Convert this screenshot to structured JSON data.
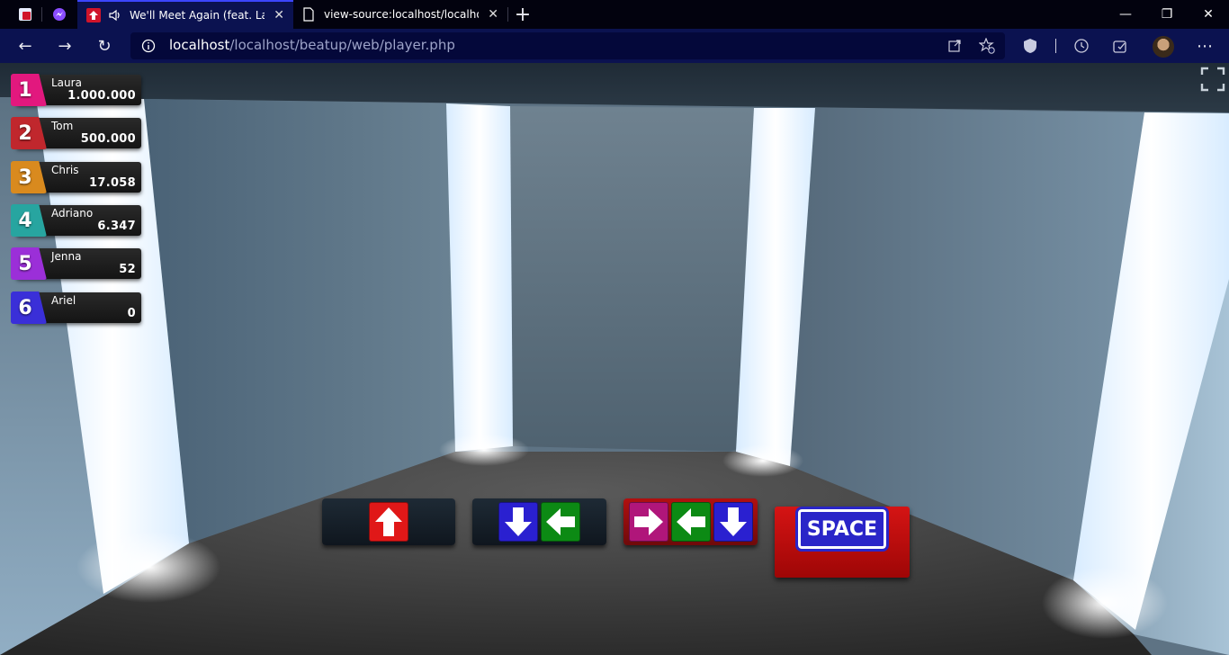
{
  "browser": {
    "tabs": [
      {
        "title": "We'll Meet Again (feat. Laura"
      },
      {
        "title": "view-source:localhost/localhost/b"
      }
    ],
    "url_host": "localhost",
    "url_path": "/localhost/beatup/web/player.php"
  },
  "leaderboard": [
    {
      "rank": "1",
      "name": "Laura",
      "score": "1.000.000",
      "color": "#e2187e"
    },
    {
      "rank": "2",
      "name": "Tom",
      "score": "500.000",
      "color": "#c0272d"
    },
    {
      "rank": "3",
      "name": "Chris",
      "score": "17.058",
      "color": "#d98a1e"
    },
    {
      "rank": "4",
      "name": "Adriano",
      "score": "6.347",
      "color": "#27a5a0"
    },
    {
      "rank": "5",
      "name": "Jenna",
      "score": "52",
      "color": "#9b2fd8"
    },
    {
      "rank": "6",
      "name": "Ariel",
      "score": "0",
      "color": "#3a2fd8"
    }
  ],
  "key_sequences": [
    {
      "keys": [
        "up"
      ]
    },
    {
      "keys": [
        "down",
        "left"
      ]
    },
    {
      "keys": [
        "right",
        "left",
        "down"
      ]
    }
  ],
  "space_key": {
    "label": "SPACE"
  }
}
